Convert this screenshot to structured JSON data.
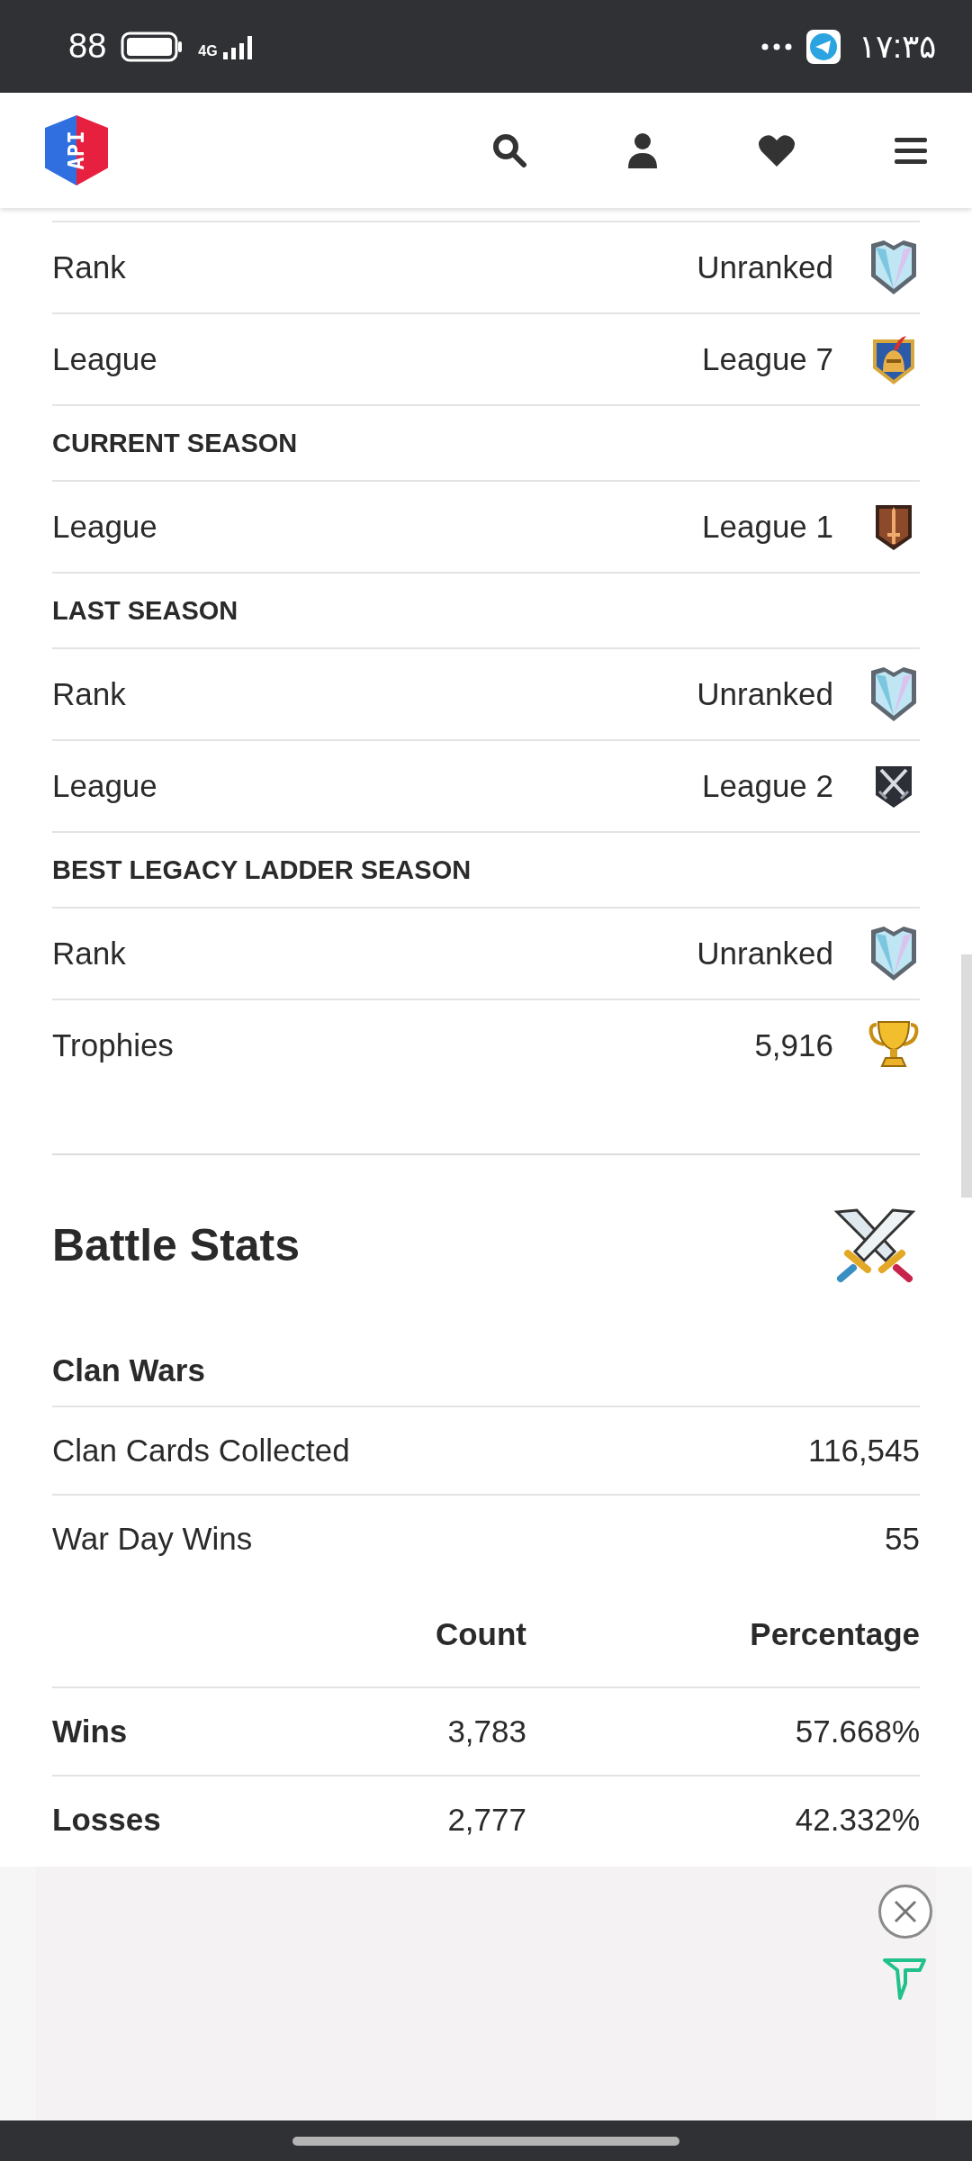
{
  "status_bar": {
    "battery": "88",
    "network": "4G",
    "time": "۱۷:۳۵"
  },
  "header": {
    "logo_text": "API"
  },
  "league_items": [
    {
      "kind": "row",
      "label": "Rank",
      "value": "Unranked"
    },
    {
      "kind": "row",
      "label": "League",
      "value": "League 7"
    },
    {
      "kind": "heading",
      "label": "CURRENT SEASON"
    },
    {
      "kind": "row",
      "label": "League",
      "value": "League 1"
    },
    {
      "kind": "heading",
      "label": "LAST SEASON"
    },
    {
      "kind": "row",
      "label": "Rank",
      "value": "Unranked"
    },
    {
      "kind": "row",
      "label": "League",
      "value": "League 2"
    },
    {
      "kind": "heading",
      "label": "BEST LEGACY LADDER SEASON"
    },
    {
      "kind": "row",
      "label": "Rank",
      "value": "Unranked"
    },
    {
      "kind": "row",
      "label": "Trophies",
      "value": "5,916"
    }
  ],
  "battle_stats": {
    "title": "Battle Stats",
    "subheading": "Clan Wars",
    "rows": [
      {
        "label": "Clan Cards Collected",
        "value": "116,545"
      },
      {
        "label": "War Day Wins",
        "value": "55"
      }
    ],
    "table": {
      "columns": [
        "Count",
        "Percentage"
      ],
      "rows": [
        {
          "label": "Wins",
          "count": "3,783",
          "percentage": "57.668%"
        },
        {
          "label": "Losses",
          "count": "2,777",
          "percentage": "42.332%"
        }
      ]
    }
  }
}
